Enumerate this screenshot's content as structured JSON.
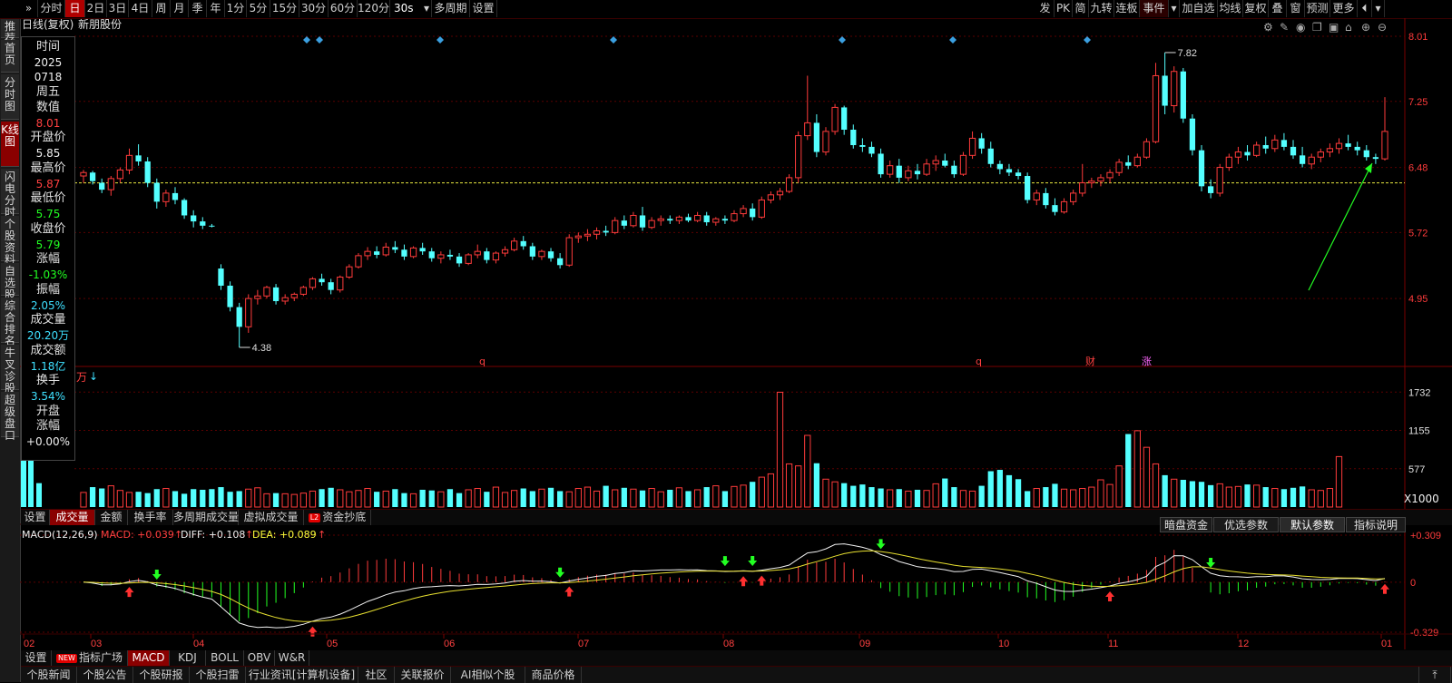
{
  "toolbar": {
    "back_icon": "chevrons-right-icon",
    "periods": [
      "分时",
      "日",
      "2日",
      "3日",
      "4日",
      "周",
      "月",
      "季",
      "年",
      "1分",
      "5分",
      "15分",
      "30分",
      "60分",
      "120分"
    ],
    "active_period": "日",
    "interval_value": "30s",
    "multi_period": "多周期",
    "settings": "设置",
    "right_items": [
      "发",
      "PK",
      "简",
      "九转",
      "连板",
      "事件",
      "加自选",
      "均线",
      "复权",
      "叠",
      "窗",
      "预测",
      "更多"
    ]
  },
  "left_nav": [
    "推荐",
    "首页",
    "分时图",
    "K线图",
    "闪电分时",
    "个股资料",
    "自选股",
    "综合排名",
    "牛叉诊股",
    "超级盘口"
  ],
  "left_nav_active": "K线图",
  "chart_header": {
    "mode": "日线(复权)",
    "stock_name": "新朋股份"
  },
  "info_panel": {
    "time_label": "时间",
    "year": "2025",
    "date": "0718",
    "weekday": "周五",
    "value_label": "数值",
    "value": "8.01",
    "open_label": "开盘价",
    "open": "5.85",
    "high_label": "最高价",
    "high": "5.87",
    "low_label": "最低价",
    "low": "5.75",
    "close_label": "收盘价",
    "close": "5.79",
    "change_label": "涨幅",
    "change": "-1.03%",
    "amplitude_label": "振幅",
    "amplitude": "2.05%",
    "volume_label": "成交量",
    "volume": "20.20万",
    "amount_label": "成交额",
    "amount": "1.18亿",
    "turnover_label": "换手",
    "turnover": "3.54%",
    "open_change_label1": "开盘",
    "open_change_label2": "涨幅",
    "open_change": "+0.00%"
  },
  "price_axis": [
    "8.01",
    "7.25",
    "6.48",
    "5.72",
    "4.95"
  ],
  "high_mark": "7.82",
  "low_mark": "4.38",
  "event_markers": [
    "q",
    "q",
    "财",
    "涨"
  ],
  "volume_unit": "万",
  "volume_axis": [
    "1732",
    "1155",
    "577"
  ],
  "volume_scale": "X1000",
  "volume_tabs": [
    "设置",
    "成交量",
    "金额",
    "换手率",
    "多周期成交量",
    "虚拟成交量",
    "资金抄底"
  ],
  "volume_tab_active": "成交量",
  "l2_badge": "L2",
  "macd": {
    "title": "MACD(12,26,9)",
    "macd_label": "MACD: +0.039",
    "diff_label": "DIFF: +0.108",
    "dea_label": "DEA: +0.089",
    "axis": [
      "+0.309",
      "0",
      "-0.329"
    ],
    "buttons": [
      "暗盘资金",
      "优选参数",
      "默认参数",
      "指标说明"
    ],
    "active_button": "默认参数"
  },
  "months": [
    "02",
    "03",
    "04",
    "05",
    "06",
    "07",
    "08",
    "09",
    "10",
    "11",
    "12",
    "01"
  ],
  "indicator_tabs": [
    "设置",
    "指标广场",
    "MACD",
    "KDJ",
    "BOLL",
    "OBV",
    "W&R"
  ],
  "indicator_tab_active": "MACD",
  "new_badge": "NEW",
  "bottom_links": [
    "个股新闻",
    "个股公告",
    "个股研报",
    "个股扫雷",
    "行业资讯[计算机设备]",
    "社区",
    "关联报价",
    "AI相似个股",
    "商品价格"
  ],
  "chart_data": {
    "type": "candlestick",
    "price_axis_ticks": [
      8.01,
      7.25,
      6.48,
      5.72,
      4.95
    ],
    "ylim": [
      4.2,
      8.01
    ],
    "reference_line": 6.3,
    "candles": [
      [
        6.38,
        6.45,
        6.3,
        6.42
      ],
      [
        6.42,
        6.44,
        6.28,
        6.32
      ],
      [
        6.3,
        6.35,
        6.18,
        6.22
      ],
      [
        6.22,
        6.38,
        6.15,
        6.35
      ],
      [
        6.35,
        6.48,
        6.3,
        6.45
      ],
      [
        6.45,
        6.7,
        6.4,
        6.62
      ],
      [
        6.62,
        6.75,
        6.5,
        6.55
      ],
      [
        6.55,
        6.6,
        6.25,
        6.3
      ],
      [
        6.3,
        6.35,
        6.0,
        6.08
      ],
      [
        6.08,
        6.22,
        6.02,
        6.18
      ],
      [
        6.18,
        6.25,
        6.05,
        6.1
      ],
      [
        6.1,
        6.12,
        5.88,
        5.92
      ],
      [
        5.92,
        5.98,
        5.78,
        5.85
      ],
      [
        5.85,
        5.9,
        5.76,
        5.8
      ],
      [
        5.8,
        5.82,
        5.78,
        5.79
      ],
      [
        5.3,
        5.35,
        5.05,
        5.1
      ],
      [
        5.1,
        5.15,
        4.8,
        4.85
      ],
      [
        4.85,
        4.9,
        4.38,
        4.62
      ],
      [
        4.62,
        5.0,
        4.55,
        4.95
      ],
      [
        4.95,
        5.05,
        4.88,
        4.98
      ],
      [
        4.98,
        5.1,
        4.95,
        5.08
      ],
      [
        5.08,
        5.12,
        4.88,
        4.92
      ],
      [
        4.92,
        5.0,
        4.88,
        4.96
      ],
      [
        4.96,
        5.02,
        4.92,
        5.0
      ],
      [
        5.0,
        5.1,
        4.98,
        5.08
      ],
      [
        5.08,
        5.2,
        5.05,
        5.18
      ],
      [
        5.18,
        5.24,
        5.1,
        5.14
      ],
      [
        5.14,
        5.18,
        5.0,
        5.05
      ],
      [
        5.05,
        5.22,
        5.02,
        5.2
      ],
      [
        5.2,
        5.35,
        5.18,
        5.32
      ],
      [
        5.32,
        5.48,
        5.3,
        5.45
      ],
      [
        5.45,
        5.55,
        5.4,
        5.5
      ],
      [
        5.5,
        5.56,
        5.42,
        5.46
      ],
      [
        5.46,
        5.6,
        5.44,
        5.55
      ],
      [
        5.55,
        5.62,
        5.48,
        5.52
      ],
      [
        5.52,
        5.58,
        5.4,
        5.44
      ],
      [
        5.44,
        5.56,
        5.42,
        5.54
      ],
      [
        5.54,
        5.6,
        5.46,
        5.5
      ],
      [
        5.5,
        5.54,
        5.38,
        5.42
      ],
      [
        5.42,
        5.5,
        5.36,
        5.46
      ],
      [
        5.46,
        5.52,
        5.4,
        5.44
      ],
      [
        5.44,
        5.48,
        5.32,
        5.36
      ],
      [
        5.36,
        5.48,
        5.34,
        5.46
      ],
      [
        5.46,
        5.58,
        5.42,
        5.5
      ],
      [
        5.5,
        5.54,
        5.36,
        5.4
      ],
      [
        5.4,
        5.5,
        5.36,
        5.48
      ],
      [
        5.48,
        5.56,
        5.44,
        5.52
      ],
      [
        5.52,
        5.66,
        5.5,
        5.62
      ],
      [
        5.62,
        5.68,
        5.52,
        5.56
      ],
      [
        5.56,
        5.6,
        5.4,
        5.44
      ],
      [
        5.44,
        5.52,
        5.4,
        5.5
      ],
      [
        5.5,
        5.54,
        5.38,
        5.42
      ],
      [
        5.42,
        5.48,
        5.3,
        5.34
      ],
      [
        5.34,
        5.7,
        5.32,
        5.66
      ],
      [
        5.66,
        5.72,
        5.6,
        5.68
      ],
      [
        5.68,
        5.76,
        5.62,
        5.7
      ],
      [
        5.7,
        5.78,
        5.64,
        5.74
      ],
      [
        5.74,
        5.8,
        5.68,
        5.72
      ],
      [
        5.72,
        5.9,
        5.7,
        5.86
      ],
      [
        5.86,
        5.92,
        5.76,
        5.8
      ],
      [
        5.8,
        5.96,
        5.78,
        5.92
      ],
      [
        5.92,
        6.02,
        5.74,
        5.78
      ],
      [
        5.78,
        5.9,
        5.76,
        5.86
      ],
      [
        5.86,
        5.92,
        5.8,
        5.88
      ],
      [
        5.88,
        5.92,
        5.82,
        5.86
      ],
      [
        5.86,
        5.92,
        5.82,
        5.9
      ],
      [
        5.9,
        5.94,
        5.84,
        5.86
      ],
      [
        5.86,
        5.96,
        5.84,
        5.92
      ],
      [
        5.92,
        5.96,
        5.8,
        5.84
      ],
      [
        5.84,
        5.9,
        5.8,
        5.88
      ],
      [
        5.88,
        5.92,
        5.82,
        5.86
      ],
      [
        5.86,
        5.98,
        5.84,
        5.94
      ],
      [
        5.94,
        6.04,
        5.9,
        6.0
      ],
      [
        6.0,
        6.06,
        5.86,
        5.9
      ],
      [
        5.9,
        6.14,
        5.88,
        6.1
      ],
      [
        6.1,
        6.2,
        6.06,
        6.16
      ],
      [
        6.16,
        6.24,
        6.1,
        6.2
      ],
      [
        6.2,
        6.4,
        6.18,
        6.36
      ],
      [
        6.36,
        6.9,
        6.3,
        6.85
      ],
      [
        6.85,
        7.55,
        6.8,
        7.0
      ],
      [
        7.0,
        7.1,
        6.6,
        6.66
      ],
      [
        6.66,
        6.95,
        6.62,
        6.9
      ],
      [
        6.9,
        7.22,
        6.86,
        7.18
      ],
      [
        7.18,
        7.2,
        6.86,
        6.92
      ],
      [
        6.92,
        6.98,
        6.7,
        6.74
      ],
      [
        6.74,
        6.82,
        6.66,
        6.72
      ],
      [
        6.72,
        6.78,
        6.6,
        6.64
      ],
      [
        6.64,
        6.7,
        6.36,
        6.4
      ],
      [
        6.4,
        6.56,
        6.36,
        6.5
      ],
      [
        6.5,
        6.58,
        6.3,
        6.36
      ],
      [
        6.36,
        6.5,
        6.32,
        6.44
      ],
      [
        6.44,
        6.52,
        6.34,
        6.4
      ],
      [
        6.4,
        6.58,
        6.38,
        6.52
      ],
      [
        6.52,
        6.62,
        6.44,
        6.56
      ],
      [
        6.56,
        6.64,
        6.48,
        6.5
      ],
      [
        6.5,
        6.56,
        6.36,
        6.4
      ],
      [
        6.4,
        6.66,
        6.38,
        6.62
      ],
      [
        6.62,
        6.9,
        6.58,
        6.82
      ],
      [
        6.82,
        6.88,
        6.64,
        6.7
      ],
      [
        6.7,
        6.78,
        6.48,
        6.52
      ],
      [
        6.52,
        6.56,
        6.4,
        6.46
      ],
      [
        6.46,
        6.52,
        6.38,
        6.42
      ],
      [
        6.42,
        6.46,
        6.34,
        6.38
      ],
      [
        6.38,
        6.42,
        6.06,
        6.1
      ],
      [
        6.1,
        6.22,
        6.04,
        6.18
      ],
      [
        6.18,
        6.24,
        6.0,
        6.04
      ],
      [
        6.04,
        6.12,
        5.92,
        5.96
      ],
      [
        5.96,
        6.12,
        5.94,
        6.08
      ],
      [
        6.08,
        6.22,
        6.04,
        6.18
      ],
      [
        6.18,
        6.52,
        6.14,
        6.3
      ],
      [
        6.3,
        6.36,
        6.24,
        6.32
      ],
      [
        6.32,
        6.4,
        6.26,
        6.36
      ],
      [
        6.36,
        6.46,
        6.3,
        6.42
      ],
      [
        6.42,
        6.58,
        6.38,
        6.54
      ],
      [
        6.54,
        6.62,
        6.46,
        6.5
      ],
      [
        6.5,
        6.64,
        6.48,
        6.6
      ],
      [
        6.6,
        6.82,
        6.58,
        6.78
      ],
      [
        6.78,
        7.7,
        6.76,
        7.55
      ],
      [
        7.55,
        7.82,
        7.1,
        7.2
      ],
      [
        7.2,
        7.66,
        7.12,
        7.6
      ],
      [
        7.6,
        7.64,
        7.0,
        7.05
      ],
      [
        7.05,
        7.1,
        6.62,
        6.68
      ],
      [
        6.68,
        6.74,
        6.2,
        6.26
      ],
      [
        6.26,
        6.34,
        6.12,
        6.18
      ],
      [
        6.18,
        6.52,
        6.14,
        6.48
      ],
      [
        6.48,
        6.64,
        6.44,
        6.6
      ],
      [
        6.6,
        6.72,
        6.52,
        6.66
      ],
      [
        6.66,
        6.74,
        6.56,
        6.62
      ],
      [
        6.62,
        6.78,
        6.6,
        6.74
      ],
      [
        6.74,
        6.84,
        6.64,
        6.7
      ],
      [
        6.7,
        6.86,
        6.66,
        6.8
      ],
      [
        6.8,
        6.88,
        6.68,
        6.72
      ],
      [
        6.72,
        6.8,
        6.58,
        6.62
      ],
      [
        6.62,
        6.72,
        6.48,
        6.52
      ],
      [
        6.52,
        6.64,
        6.46,
        6.6
      ],
      [
        6.6,
        6.7,
        6.54,
        6.66
      ],
      [
        6.66,
        6.76,
        6.6,
        6.7
      ],
      [
        6.7,
        6.82,
        6.64,
        6.76
      ],
      [
        6.76,
        6.86,
        6.68,
        6.72
      ],
      [
        6.72,
        6.78,
        6.62,
        6.68
      ],
      [
        6.68,
        6.74,
        6.56,
        6.6
      ],
      [
        6.6,
        6.64,
        6.52,
        6.58
      ],
      [
        6.58,
        7.3,
        6.56,
        6.9
      ]
    ],
    "volume_ticks": [
      1732,
      1155,
      577
    ],
    "volume_max": 1900,
    "volumes": [
      1050,
      870,
      360,
      220,
      300,
      280,
      320,
      250,
      220,
      230,
      210,
      270,
      280,
      240,
      200,
      270,
      260,
      270,
      300,
      230,
      240,
      270,
      290,
      200,
      210,
      200,
      190,
      210,
      240,
      270,
      290,
      260,
      230,
      250,
      280,
      230,
      240,
      270,
      210,
      200,
      260,
      250,
      230,
      270,
      210,
      260,
      280,
      230,
      300,
      220,
      250,
      280,
      240,
      270,
      290,
      240,
      230,
      280,
      300,
      240,
      320,
      260,
      290,
      270,
      250,
      280,
      230,
      260,
      290,
      240,
      260,
      300,
      320,
      240,
      310,
      330,
      380,
      450,
      500,
      1730,
      650,
      620,
      1080,
      660,
      420,
      380,
      360,
      320,
      340,
      300,
      280,
      260,
      270,
      240,
      260,
      250,
      350,
      430,
      300,
      250,
      240,
      320,
      540,
      560,
      480,
      420,
      240,
      280,
      300,
      350,
      270,
      260,
      280,
      300,
      410,
      340,
      620,
      1100,
      1150,
      900,
      650,
      480,
      420,
      410,
      390,
      380,
      330,
      350,
      300,
      310,
      340,
      330,
      300,
      280,
      270,
      290,
      310,
      260,
      250,
      280,
      760
    ],
    "macd_axis": [
      0.309,
      0,
      -0.329
    ]
  }
}
